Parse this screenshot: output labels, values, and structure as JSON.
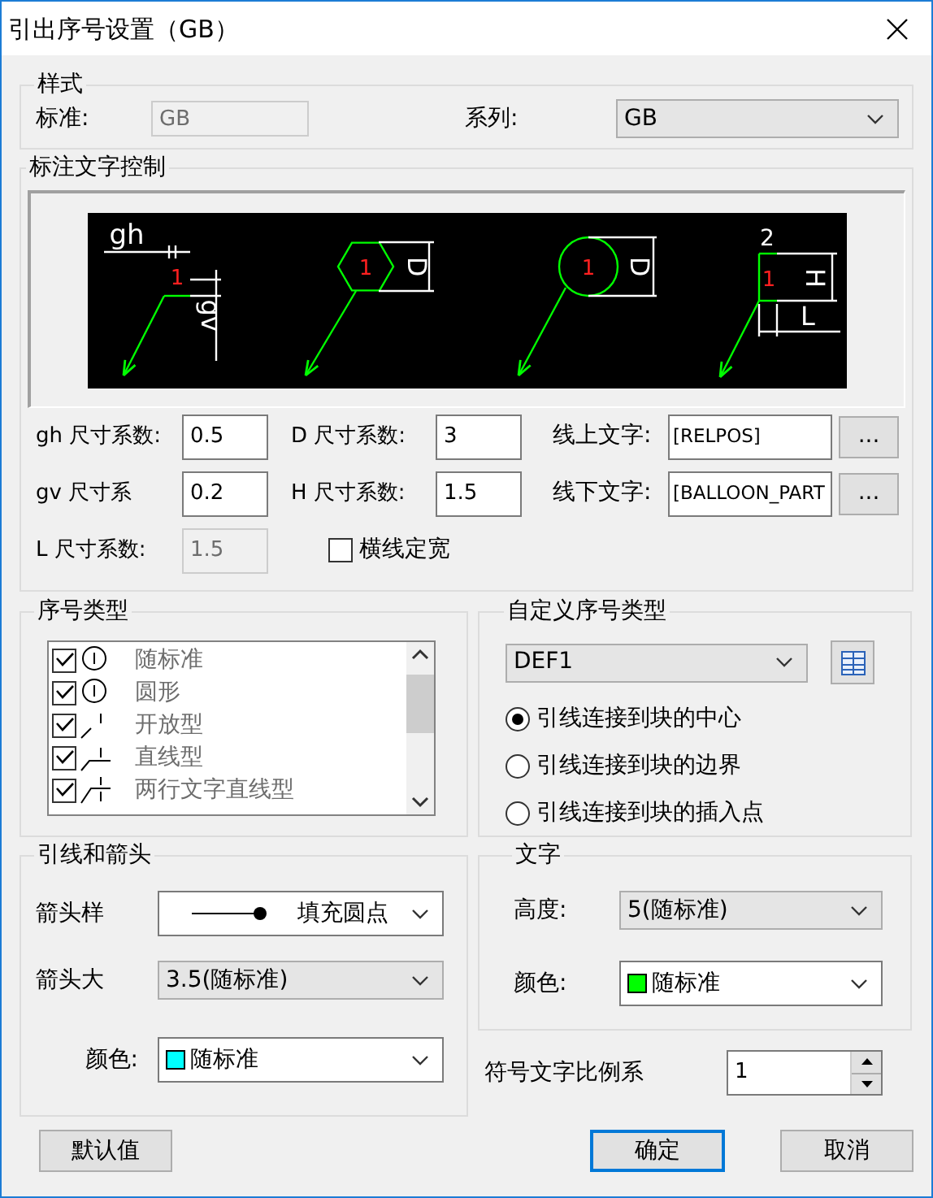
{
  "window": {
    "title": "引出序号设置（GB）"
  },
  "style_group": {
    "title": "样式",
    "standard_label": "标准:",
    "standard": {
      "value": "GB",
      "disabled": true
    },
    "series_label": "系列:",
    "series": {
      "value": "GB",
      "kind": "list"
    }
  },
  "annotation_group": {
    "title": "标注文字控制",
    "preview": [
      {
        "kind": "plain",
        "number": "1",
        "dims": [
          "gh",
          "gv"
        ]
      },
      {
        "kind": "hexagon",
        "number": "1",
        "dims": [
          "D"
        ]
      },
      {
        "kind": "circle",
        "number": "1",
        "dims": [
          "D"
        ]
      },
      {
        "kind": "two-line",
        "number": "1",
        "dims": [
          "2",
          "H",
          "L"
        ]
      }
    ],
    "columns": [
      [
        {
          "kind": "number",
          "label": "gh 尺寸系数:",
          "value": "0.5",
          "disabled": false
        },
        {
          "kind": "number",
          "label": "gv 尺寸系",
          "value": "0.2",
          "disabled": false
        },
        {
          "kind": "number",
          "label": "L 尺寸系数:",
          "value": "1.5",
          "disabled": true
        }
      ],
      [
        {
          "kind": "number",
          "label": "D 尺寸系数:",
          "value": "3",
          "disabled": false
        },
        {
          "kind": "number",
          "label": "H 尺寸系数:",
          "value": "1.5",
          "disabled": false
        },
        {
          "kind": "checkbox",
          "label": "横线定宽",
          "checked": false
        }
      ],
      [
        {
          "kind": "text",
          "label": "线上文字:",
          "value": "[RELPOS]",
          "button": "..."
        },
        {
          "kind": "text",
          "label": "线下文字:",
          "value": "[BALLOON_PART",
          "button": "..."
        }
      ]
    ]
  },
  "number_types": {
    "title": "序号类型",
    "items": [
      {
        "label": "随标准",
        "kind": "circle",
        "checked": true
      },
      {
        "label": "圆形",
        "kind": "circle",
        "checked": true
      },
      {
        "label": "开放型",
        "kind": "open",
        "checked": true
      },
      {
        "label": "直线型",
        "kind": "line",
        "checked": true
      },
      {
        "label": "两行文字直线型",
        "kind": "two-line",
        "checked": true
      }
    ]
  },
  "custom_types": {
    "title": "自定义序号类型",
    "combo": {
      "value": "DEF1",
      "kind": "list"
    },
    "options": [
      {
        "label": "引线连接到块的中心",
        "selected": true
      },
      {
        "label": "引线连接到块的边界",
        "selected": false
      },
      {
        "label": "引线连接到块的插入点",
        "selected": false
      }
    ]
  },
  "leader_group": {
    "title": "引线和箭头",
    "rows": [
      {
        "label": "箭头样",
        "value": "填充圆点",
        "kind": "arrowhead"
      },
      {
        "label": "箭头大",
        "value": "3.5(随标准)",
        "kind": "list"
      },
      {
        "label": "颜色:",
        "value": "随标准",
        "kind": "color",
        "color": "#00ffff"
      }
    ]
  },
  "text_group": {
    "title": "文字",
    "rows": [
      {
        "label": "高度:",
        "value": "5(随标准)",
        "kind": "list"
      },
      {
        "label": "颜色:",
        "value": "随标准",
        "kind": "color",
        "color": "#00ff00"
      }
    ]
  },
  "scale": {
    "label": "符号文字比例系",
    "value": "1"
  },
  "buttons": [
    {
      "label": "默认值",
      "default": false
    },
    {
      "label": "确定",
      "default": true
    },
    {
      "label": "取消",
      "default": false
    }
  ]
}
